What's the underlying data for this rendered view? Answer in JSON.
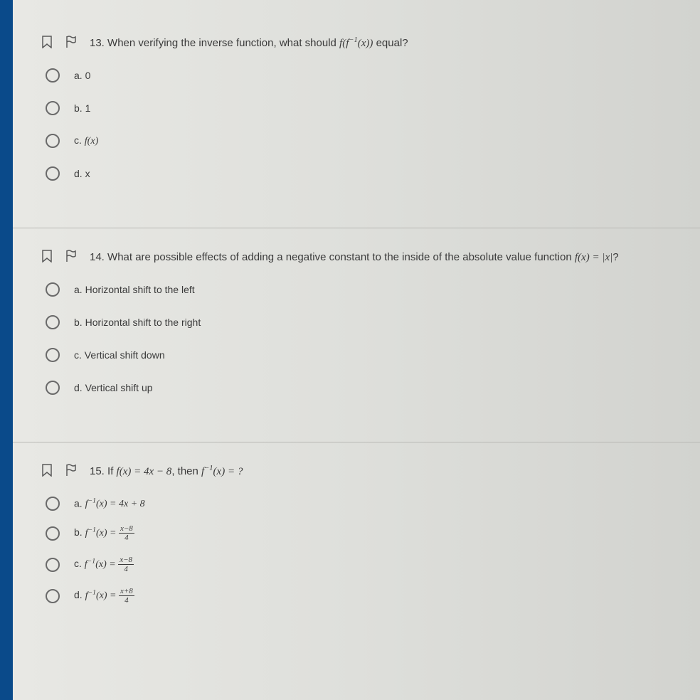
{
  "questions": [
    {
      "number": "13.",
      "text_prefix": "When verifying the inverse function, what should ",
      "text_math": "f(f⁻¹(x))",
      "text_suffix": " equal?",
      "options": [
        {
          "letter": "a.",
          "text": "0",
          "is_math": false
        },
        {
          "letter": "b.",
          "text": "1",
          "is_math": false
        },
        {
          "letter": "c.",
          "text": "f(x)",
          "is_math": true
        },
        {
          "letter": "d.",
          "text": "x",
          "is_math": false
        }
      ]
    },
    {
      "number": "14.",
      "text_prefix": "What are possible effects of adding a negative constant to the inside of the absolute value function ",
      "text_math": "f(x) = |x|",
      "text_suffix": "?",
      "options": [
        {
          "letter": "a.",
          "text": "Horizontal shift to the left",
          "is_math": false
        },
        {
          "letter": "b.",
          "text": "Horizontal shift to the right",
          "is_math": false
        },
        {
          "letter": "c.",
          "text": "Vertical shift down",
          "is_math": false
        },
        {
          "letter": "d.",
          "text": "Vertical shift up",
          "is_math": false
        }
      ]
    },
    {
      "number": "15.",
      "text_prefix": "If ",
      "text_math": "f(x) = 4x − 8",
      "text_mid": ", then ",
      "text_math2": "f⁻¹(x) = ?",
      "text_suffix": "",
      "options": [
        {
          "letter": "a.",
          "prefix": "f⁻¹(x) = ",
          "text": "4x + 8",
          "is_math": true
        },
        {
          "letter": "b.",
          "prefix": "f⁻¹(x) = ",
          "frac_num": "x−8",
          "frac_den": "4",
          "is_frac": true
        },
        {
          "letter": "c.",
          "prefix": "f⁻¹(x) = ",
          "frac_num": "x−8",
          "frac_den": "4",
          "is_frac": true
        },
        {
          "letter": "d.",
          "prefix": "f⁻¹(x) = ",
          "frac_num": "x+8",
          "frac_den": "4",
          "is_frac": true
        }
      ]
    }
  ]
}
